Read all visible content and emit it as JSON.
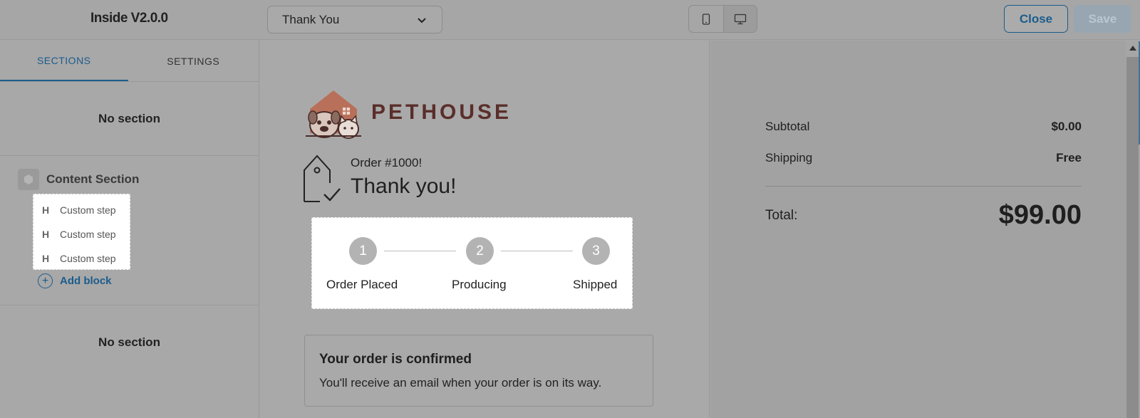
{
  "app": {
    "title": "Inside V2.0.0"
  },
  "topbar": {
    "page_select_value": "Thank You",
    "device_options": [
      "mobile-icon",
      "desktop-icon"
    ],
    "active_device": "desktop",
    "close_label": "Close",
    "save_label": "Save"
  },
  "sidebar": {
    "tabs": [
      {
        "label": "SECTIONS",
        "active": true
      },
      {
        "label": "SETTINGS",
        "active": false
      }
    ],
    "top_section_label": "No section",
    "content_section": {
      "label": "Content Section",
      "blocks": [
        {
          "icon": "heading-icon",
          "glyph": "H",
          "label": "Custom step"
        },
        {
          "icon": "heading-icon",
          "glyph": "H",
          "label": "Custom step"
        },
        {
          "icon": "heading-icon",
          "glyph": "H",
          "label": "Custom step"
        }
      ],
      "add_block_label": "Add block"
    },
    "bottom_section_label": "No section"
  },
  "preview": {
    "brand_name": "PETHOUSE",
    "order_number": "Order #1000!",
    "thank_you": "Thank you!",
    "steps": [
      {
        "number": "1",
        "label": "Order Placed"
      },
      {
        "number": "2",
        "label": "Producing"
      },
      {
        "number": "3",
        "label": "Shipped"
      }
    ],
    "confirm": {
      "title": "Your order is confirmed",
      "text": "You'll receive an email when your order is on its way."
    }
  },
  "summary": {
    "subtotal_label": "Subtotal",
    "subtotal_value": "$0.00",
    "shipping_label": "Shipping",
    "shipping_value": "Free",
    "total_label": "Total:",
    "total_value": "$99.00"
  },
  "colors": {
    "accent": "#1b5c8c",
    "brand": "#5a2e2a",
    "logo_house": "#b8705a"
  }
}
